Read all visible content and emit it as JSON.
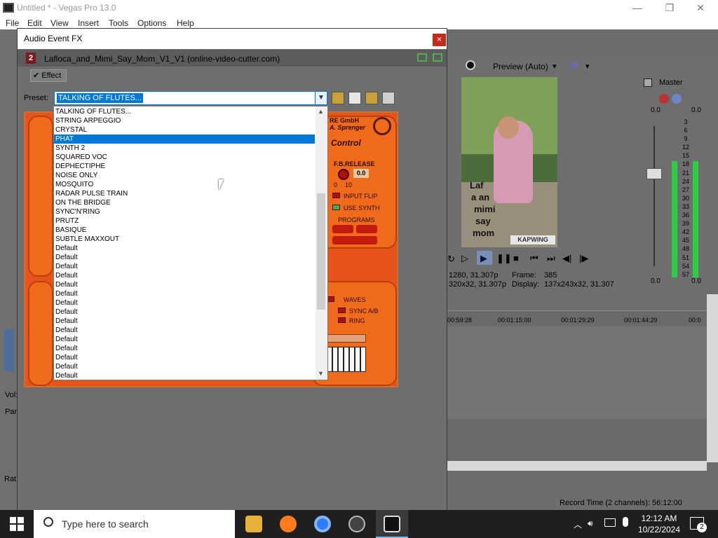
{
  "app": {
    "title": "Untitled * - Vegas Pro 13.0",
    "menu": [
      "File",
      "Edit",
      "View",
      "Insert",
      "Tools",
      "Options",
      "Help"
    ],
    "min_glyph": "—",
    "max_glyph": "❐",
    "close_glyph": "✕"
  },
  "dialog": {
    "title": "Audio Event FX",
    "close_glyph": "×",
    "chain_number": "2",
    "chain_title": "Lafloca_and_Mimi_Say_Mom_V1_V1 (online-video-cutter.com)",
    "effect_tab": "Effect",
    "preset_label": "Preset:",
    "preset_value": "TALKING OF FLUTES...",
    "preset_items": [
      "TALKING OF FLUTES...",
      "STRING ARPEGGIO",
      "CRYSTAL",
      "PHAT",
      "SYNTH 2",
      "SQUARED VOC",
      "DEPHECTIPHE",
      "NOISE ONLY",
      "MOSQUITO",
      "RADAR PULSE TRAIN",
      "ON THE BRIDGE",
      "SYNC'N'RING",
      "PRUTZ",
      "BASIQUE",
      "SUBTLE MAXXOUT",
      "Default",
      "Default",
      "Default",
      "Default",
      "Default",
      "Default",
      "Default",
      "Default",
      "Default",
      "Default",
      "Default",
      "Default",
      "Default",
      "Default",
      "Default"
    ],
    "highlighted_index": 3
  },
  "plugin": {
    "brand_line1": "RE GmbH",
    "brand_line2": "A. Sprenger",
    "control": "Control",
    "fb_release": "F.B.RELEASE",
    "fb_value": "0.0",
    "knob_min": "0",
    "knob_max": "10",
    "input_flip": "INPUT FLIP",
    "use_synth": "USE SYNTH",
    "programs": "PROGRAMS",
    "waves": "WAVES",
    "sync_ab": "SYNC A/B",
    "ring": "RING"
  },
  "preview": {
    "label": "Preview (Auto)",
    "frame_label": "Frame:",
    "frame_value": "385",
    "display_label": "Display:",
    "display_value": "137x243x32, 31.307",
    "project_res": "1280, 31.307p",
    "preview_res": "320x32, 31.307p",
    "video_caption": [
      "Laf",
      "a an",
      "mimi",
      "say",
      "mom"
    ],
    "watermark": "KAPWING"
  },
  "master": {
    "label": "Master",
    "scale": [
      "3",
      "6",
      "9",
      "12",
      "15",
      "18",
      "21",
      "24",
      "27",
      "30",
      "33",
      "36",
      "39",
      "42",
      "45",
      "48",
      "51",
      "54",
      "57"
    ],
    "left_value": "0.0",
    "right_value": "0.0",
    "bottom_left": "0.0",
    "bottom_right": "0.0"
  },
  "timeline": {
    "times": [
      "00:59:28",
      "00:01:15:00",
      "00:01:29:29",
      "00:01:44:29",
      "00:0"
    ]
  },
  "left_panel": {
    "vol": "Vol:",
    "pan": "Pan",
    "rate": "Rat"
  },
  "status": {
    "record_time": "Record Time (2 channels): 56:12:00"
  },
  "taskbar": {
    "search_placeholder": "Type here to search",
    "time": "12:12 AM",
    "date": "10/22/2024",
    "notification_count": "2"
  },
  "colors": {
    "accent": "#0078d7",
    "plugin_orange": "#e8531c",
    "close_red": "#c42b1c"
  }
}
